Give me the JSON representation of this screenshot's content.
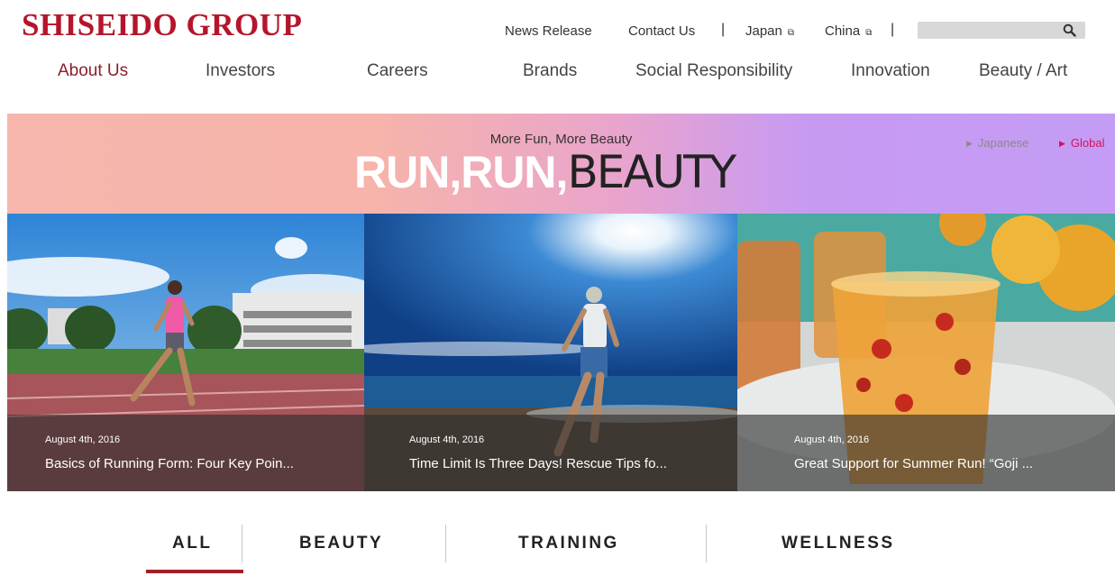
{
  "header": {
    "logo": "SHISEIDO GROUP",
    "utility_links": {
      "news_release": "News Release",
      "contact_us": "Contact Us",
      "japan": "Japan",
      "china": "China"
    },
    "separator": "|",
    "search": {
      "placeholder": ""
    }
  },
  "nav": {
    "items": [
      "About Us",
      "Investors",
      "Careers",
      "Brands",
      "Social Responsibility",
      "Innovation",
      "Beauty / Art"
    ],
    "active": "About Us"
  },
  "banner": {
    "tagline": "More Fun, More Beauty",
    "title_bold": "RUN,RUN,",
    "title_light": "BEAUTY",
    "languages": [
      "Japanese",
      "Global"
    ],
    "active_language": "Global"
  },
  "cards": [
    {
      "date": "August 4th, 2016",
      "title": "Basics of Running Form: Four Key Poin..."
    },
    {
      "date": "August 4th, 2016",
      "title": "Time Limit Is Three Days! Rescue Tips fo..."
    },
    {
      "date": "August 4th, 2016",
      "title": "Great Support for Summer Run! “Goji ..."
    }
  ],
  "tabs": {
    "items": [
      "ALL",
      "BEAUTY",
      "TRAINING",
      "WELLNESS"
    ],
    "active": "ALL"
  },
  "colors": {
    "brand": "#b5152b",
    "accent_underline": "#a41f27",
    "global_link": "#d8115a"
  },
  "icons": {
    "search": "search-icon",
    "external": "external-window-icon",
    "arrow": "triangle-right-icon"
  }
}
